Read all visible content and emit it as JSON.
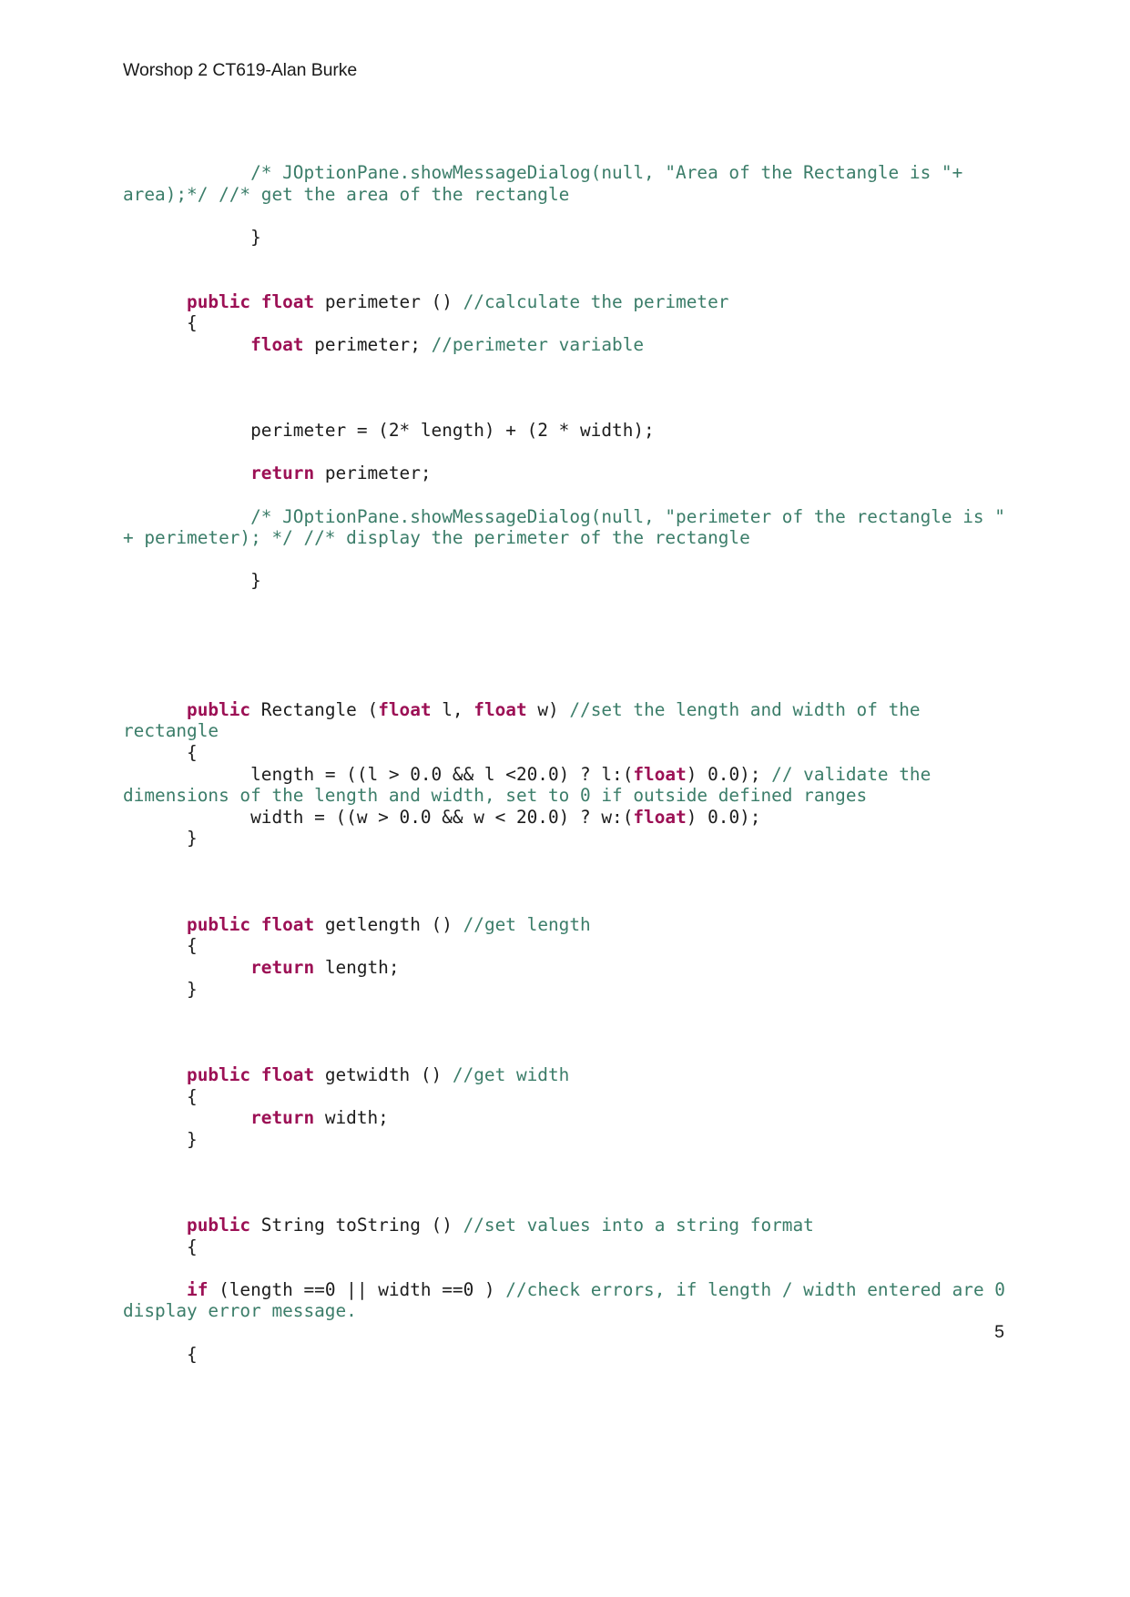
{
  "document": {
    "header": "Worshop 2 CT619-Alan Burke",
    "page_number": "5",
    "colors": {
      "keyword": "#9c1055",
      "comment": "#3b7d69",
      "plain": "#1c1c1c",
      "background": "#ffffff"
    }
  },
  "code": {
    "lines": [
      {
        "id": "l1",
        "segments": [
          {
            "t": "            ",
            "c": "pn"
          },
          {
            "t": "/* JOptionPane.showMessageDialog(null, \"Area of the Rectangle is \"+ area);*/ //* get the area of the rectangle",
            "c": "cm"
          }
        ]
      },
      {
        "id": "l2",
        "segments": []
      },
      {
        "id": "l3",
        "segments": [
          {
            "t": "            }",
            "c": "pn"
          }
        ]
      },
      {
        "id": "l4",
        "segments": []
      },
      {
        "id": "l5",
        "segments": []
      },
      {
        "id": "l6",
        "segments": [
          {
            "t": "      ",
            "c": "pn"
          },
          {
            "t": "public float",
            "c": "kw"
          },
          {
            "t": " perimeter () ",
            "c": "pn"
          },
          {
            "t": "//calculate the perimeter",
            "c": "cm"
          }
        ]
      },
      {
        "id": "l7",
        "segments": [
          {
            "t": "      {",
            "c": "pn"
          }
        ]
      },
      {
        "id": "l8",
        "segments": [
          {
            "t": "            ",
            "c": "pn"
          },
          {
            "t": "float",
            "c": "kw"
          },
          {
            "t": " perimeter; ",
            "c": "pn"
          },
          {
            "t": "//perimeter variable",
            "c": "cm"
          }
        ]
      },
      {
        "id": "l9",
        "segments": []
      },
      {
        "id": "l10",
        "segments": []
      },
      {
        "id": "l11",
        "segments": []
      },
      {
        "id": "l12",
        "segments": [
          {
            "t": "            perimeter = (2* length) + (2 * width);",
            "c": "pn"
          }
        ]
      },
      {
        "id": "l13",
        "segments": []
      },
      {
        "id": "l14",
        "segments": [
          {
            "t": "            ",
            "c": "pn"
          },
          {
            "t": "return",
            "c": "kw"
          },
          {
            "t": " perimeter;",
            "c": "pn"
          }
        ]
      },
      {
        "id": "l15",
        "segments": []
      },
      {
        "id": "l16",
        "segments": [
          {
            "t": "            ",
            "c": "pn"
          },
          {
            "t": "/* JOptionPane.showMessageDialog(null, \"perimeter of the rectangle is \" + perimeter); */ //* display the perimeter of the rectangle",
            "c": "cm"
          }
        ]
      },
      {
        "id": "l17",
        "segments": []
      },
      {
        "id": "l18",
        "segments": [
          {
            "t": "            }",
            "c": "pn"
          }
        ]
      },
      {
        "id": "l19",
        "segments": []
      },
      {
        "id": "l20",
        "segments": []
      },
      {
        "id": "l21",
        "segments": []
      },
      {
        "id": "l22",
        "segments": []
      },
      {
        "id": "l23",
        "segments": []
      },
      {
        "id": "l24",
        "segments": [
          {
            "t": "      ",
            "c": "pn"
          },
          {
            "t": "public",
            "c": "kw"
          },
          {
            "t": " Rectangle (",
            "c": "pn"
          },
          {
            "t": "float",
            "c": "kw"
          },
          {
            "t": " l, ",
            "c": "pn"
          },
          {
            "t": "float",
            "c": "kw"
          },
          {
            "t": " w) ",
            "c": "pn"
          },
          {
            "t": "//set the length and width of the rectangle",
            "c": "cm"
          }
        ]
      },
      {
        "id": "l25",
        "segments": [
          {
            "t": "      {",
            "c": "pn"
          }
        ]
      },
      {
        "id": "l26",
        "segments": [
          {
            "t": "            length = ((l > 0.0 && l <20.0) ? l:(",
            "c": "pn"
          },
          {
            "t": "float",
            "c": "kw"
          },
          {
            "t": ") 0.0); ",
            "c": "pn"
          },
          {
            "t": "// validate the dimensions of the length and width, set to 0 if outside defined ranges",
            "c": "cm"
          }
        ]
      },
      {
        "id": "l27",
        "segments": [
          {
            "t": "            width = ((w > 0.0 && w < 20.0) ? w:(",
            "c": "pn"
          },
          {
            "t": "float",
            "c": "kw"
          },
          {
            "t": ") 0.0);",
            "c": "pn"
          }
        ]
      },
      {
        "id": "l28",
        "segments": [
          {
            "t": "      }",
            "c": "pn"
          }
        ]
      },
      {
        "id": "l29",
        "segments": []
      },
      {
        "id": "l30",
        "segments": []
      },
      {
        "id": "l31",
        "segments": []
      },
      {
        "id": "l32",
        "segments": [
          {
            "t": "      ",
            "c": "pn"
          },
          {
            "t": "public float",
            "c": "kw"
          },
          {
            "t": " getlength () ",
            "c": "pn"
          },
          {
            "t": "//get length",
            "c": "cm"
          }
        ]
      },
      {
        "id": "l33",
        "segments": [
          {
            "t": "      {",
            "c": "pn"
          }
        ]
      },
      {
        "id": "l34",
        "segments": [
          {
            "t": "            ",
            "c": "pn"
          },
          {
            "t": "return",
            "c": "kw"
          },
          {
            "t": " length;",
            "c": "pn"
          }
        ]
      },
      {
        "id": "l35",
        "segments": [
          {
            "t": "      }",
            "c": "pn"
          }
        ]
      },
      {
        "id": "l36",
        "segments": []
      },
      {
        "id": "l37",
        "segments": []
      },
      {
        "id": "l38",
        "segments": []
      },
      {
        "id": "l39",
        "segments": [
          {
            "t": "      ",
            "c": "pn"
          },
          {
            "t": "public float",
            "c": "kw"
          },
          {
            "t": " getwidth () ",
            "c": "pn"
          },
          {
            "t": "//get width",
            "c": "cm"
          }
        ]
      },
      {
        "id": "l40",
        "segments": [
          {
            "t": "      {",
            "c": "pn"
          }
        ]
      },
      {
        "id": "l41",
        "segments": [
          {
            "t": "            ",
            "c": "pn"
          },
          {
            "t": "return",
            "c": "kw"
          },
          {
            "t": " width;",
            "c": "pn"
          }
        ]
      },
      {
        "id": "l42",
        "segments": [
          {
            "t": "      }",
            "c": "pn"
          }
        ]
      },
      {
        "id": "l43",
        "segments": []
      },
      {
        "id": "l44",
        "segments": []
      },
      {
        "id": "l45",
        "segments": []
      },
      {
        "id": "l46",
        "segments": [
          {
            "t": "      ",
            "c": "pn"
          },
          {
            "t": "public",
            "c": "kw"
          },
          {
            "t": " String toString () ",
            "c": "pn"
          },
          {
            "t": "//set values into a string format",
            "c": "cm"
          }
        ]
      },
      {
        "id": "l47",
        "segments": [
          {
            "t": "      {",
            "c": "pn"
          }
        ]
      },
      {
        "id": "l48",
        "segments": []
      },
      {
        "id": "l49",
        "segments": [
          {
            "t": "      ",
            "c": "pn"
          },
          {
            "t": "if",
            "c": "kw"
          },
          {
            "t": " (length ==0 || width ==0 ) ",
            "c": "pn"
          },
          {
            "t": "//check errors, if length / width entered are 0 display error message.",
            "c": "cm"
          }
        ]
      },
      {
        "id": "l50",
        "segments": []
      },
      {
        "id": "l51",
        "segments": [
          {
            "t": "      {",
            "c": "pn"
          }
        ]
      }
    ]
  }
}
